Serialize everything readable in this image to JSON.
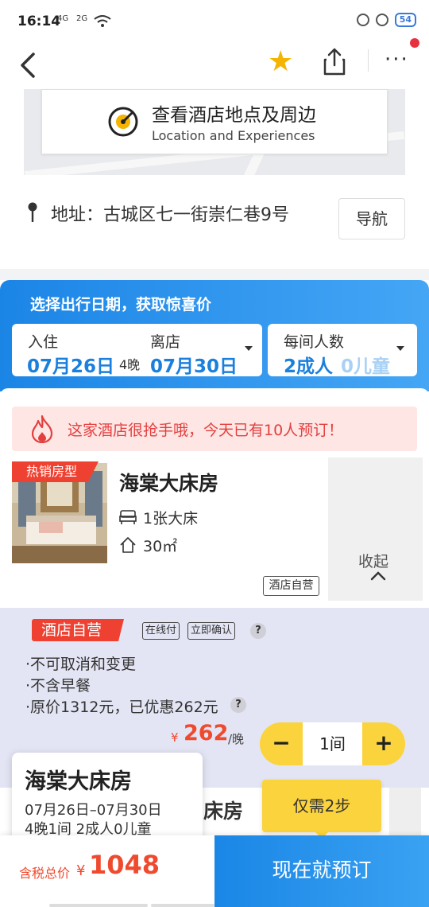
{
  "status_bar": {
    "time": "16:14",
    "signal1": "4G",
    "signal2": "2G",
    "battery": "54"
  },
  "nav": {
    "more": "···"
  },
  "map": {
    "title": "查看酒店地点及周边",
    "subtitle": "Location and Experiences"
  },
  "address": {
    "text": "地址：古城区七一街崇仁巷9号",
    "nav_button": "导航"
  },
  "dates": {
    "title": "选择出行日期，获取惊喜价",
    "checkin_label": "入住",
    "checkin_date": "07月26日",
    "nights": "4晚",
    "checkout_label": "离店",
    "checkout_date": "07月30日",
    "guests_label": "每间人数",
    "adults": "2成人",
    "children": "0儿童"
  },
  "hot_banner": {
    "text": "这家酒店很抢手哦，今天已有10人预订！"
  },
  "room": {
    "tag": "热销房型",
    "name": "海棠大床房",
    "bed": "1张大床",
    "area": "30㎡",
    "self_operated": "酒店自营",
    "collapse_label": "收起"
  },
  "rate": {
    "tag": "酒店自营",
    "pill_online": "在线付",
    "pill_instant": "立即确认",
    "help": "?",
    "policies": [
      "·不可取消和变更",
      "·不含早餐",
      "·原价1312元，已优惠262元"
    ],
    "currency": "¥",
    "price": "262",
    "per_night": "/晚",
    "minus": "−",
    "quantity": "1间",
    "plus": "+"
  },
  "under_room_name": "床房",
  "summary": {
    "room_name": "海棠大床房",
    "dates": "07月26日–07月30日",
    "detail": "4晚1间  2成人0儿童"
  },
  "steps_tooltip": "仅需2步",
  "bottom": {
    "total_label": "含税总价",
    "currency": "¥",
    "total": "1048",
    "book_button": "现在就预订"
  },
  "colors": {
    "brand_blue": "#1b85e6",
    "price_red": "#f04a2e",
    "accent_yellow": "#fbd33c",
    "tag_red": "#ef4131"
  }
}
